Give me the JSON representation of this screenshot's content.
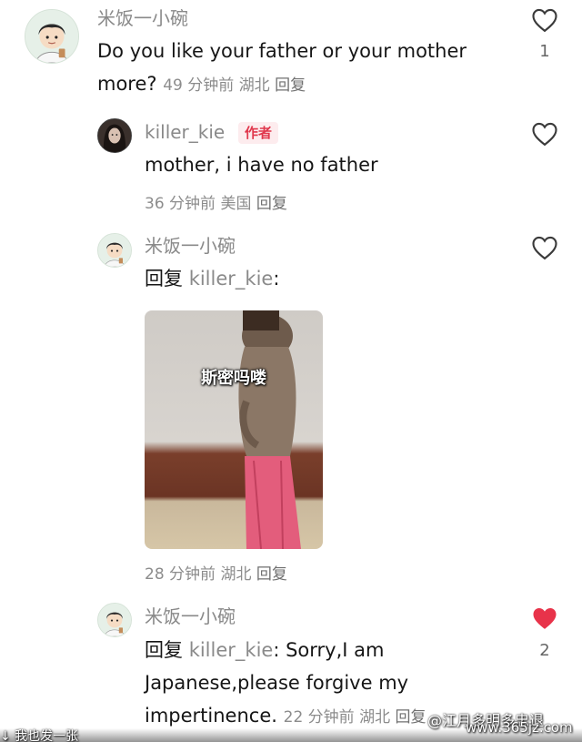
{
  "comments": [
    {
      "username": "米饭一小碗",
      "text": "Do you like your father or your mother more?",
      "meta": {
        "time": "49 分钟前",
        "location": "湖北",
        "reply": "回复"
      },
      "likes": "1",
      "liked": false
    },
    {
      "username": "killer_kie",
      "badge": "作者",
      "text": "mother, i have no father",
      "meta": {
        "time": "36 分钟前",
        "location": "美国",
        "reply": "回复"
      },
      "likes": "",
      "liked": false
    },
    {
      "username": "米饭一小碗",
      "reply_prefix": "回复",
      "mention": "killer_kie",
      "colon": ":",
      "sticker_caption": "斯密吗喽",
      "meta": {
        "time": "28 分钟前",
        "location": "湖北",
        "reply": "回复"
      },
      "likes": "",
      "liked": false
    },
    {
      "username": "米饭一小碗",
      "reply_prefix": "回复",
      "mention": "killer_kie",
      "text_line1": ": Sorry,I am",
      "text_line2": "Japanese,please forgive my",
      "text_line3": "impertinence.",
      "meta": {
        "time": "22 分钟前",
        "location": "湖北",
        "reply": "回复"
      },
      "likes": "2",
      "liked": true
    }
  ],
  "watermarks": {
    "left": "↓ 我也发一张",
    "right": "@江月多明多忠退",
    "site": "www.365jz.com"
  },
  "colors": {
    "liked_heart": "#e8334a",
    "author_badge": "#e0374c"
  }
}
